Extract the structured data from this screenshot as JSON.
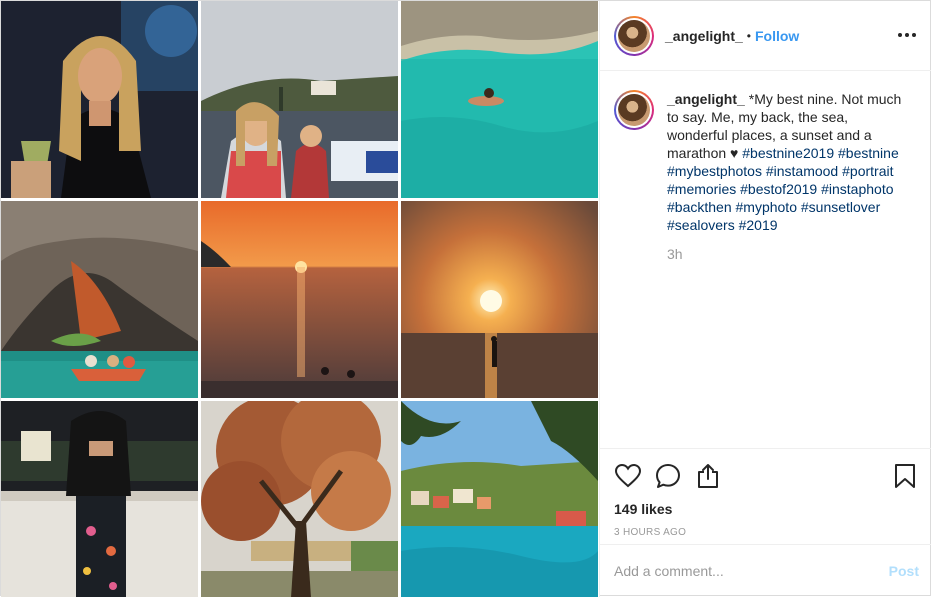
{
  "post": {
    "username": "_angelight_",
    "separator": "•",
    "follow_label": "Follow",
    "more_icon": "more-horizontal-icon",
    "caption": {
      "intro": "*My best nine. Not much to say. Me, my back, the sea, wonderful places, a sunset and a marathon",
      "heart": "♥",
      "hashtags": [
        "#bestnine2019",
        "#bestnine",
        "#mybestphotos",
        "#instamood",
        "#portrait",
        "#memories",
        "#bestof2019",
        "#instaphoto",
        "#backthen",
        "#myphoto",
        "#sunsetlover",
        "#sealovers",
        "#2019"
      ]
    },
    "caption_time": "3h",
    "likes": "149 likes",
    "time_ago": "3 HOURS AGO",
    "comment_placeholder": "Add a comment...",
    "post_label": "Post"
  },
  "icons": {
    "like": "heart-icon",
    "comment": "comment-icon",
    "share": "share-icon",
    "save": "bookmark-icon"
  },
  "grid": [
    {
      "name": "photo-portrait-drink"
    },
    {
      "name": "photo-marathon-crowd"
    },
    {
      "name": "photo-swimmer-turquoise"
    },
    {
      "name": "photo-sea-cave-boat"
    },
    {
      "name": "photo-sunset-bay"
    },
    {
      "name": "photo-sunset-sun-water"
    },
    {
      "name": "photo-back-view-terrace"
    },
    {
      "name": "photo-autumn-tree"
    },
    {
      "name": "photo-harbor-village"
    }
  ],
  "colors": {
    "follow": "#3897f0",
    "hashtag": "#003569",
    "post_disabled": "#b2dffc",
    "muted": "#999999",
    "border": "#efefef"
  }
}
